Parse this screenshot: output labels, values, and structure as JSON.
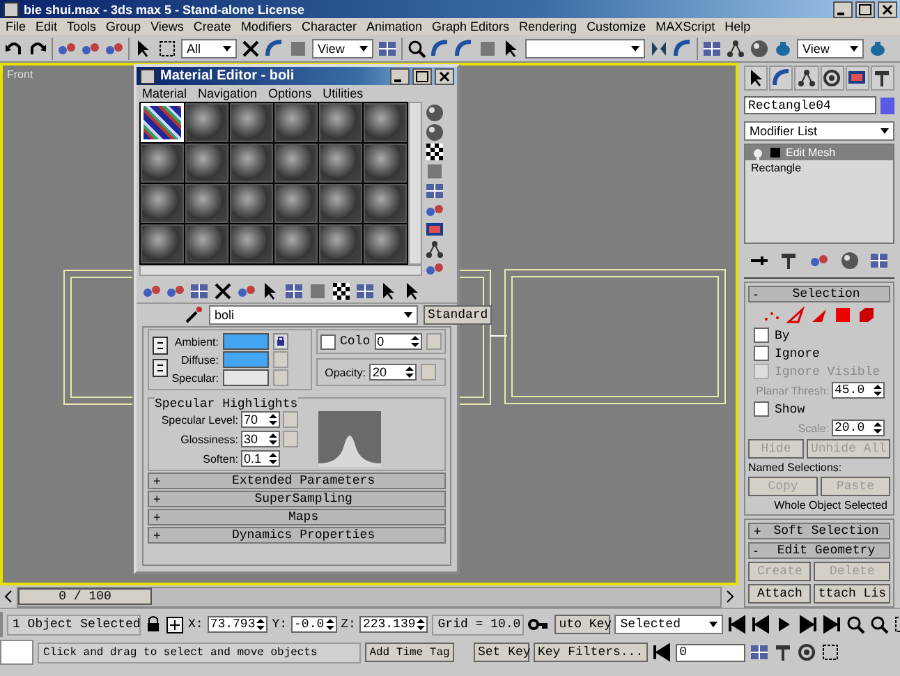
{
  "window": {
    "title": "bie shui.max - 3ds max 5 - Stand-alone License"
  },
  "menu": [
    "File",
    "Edit",
    "Tools",
    "Group",
    "Views",
    "Create",
    "Modifiers",
    "Character",
    "Animation",
    "Graph Editors",
    "Rendering",
    "Customize",
    "MAXScript",
    "Help"
  ],
  "toolbar": {
    "selection_filter": "All",
    "reference_coord": "View",
    "render_type": "View"
  },
  "viewport": {
    "label": "Front"
  },
  "time_slider": {
    "reading": "0 / 100",
    "level": 0
  },
  "material_editor": {
    "title": "Material Editor - boli",
    "menu": [
      "Material",
      "Navigation",
      "Options",
      "Utilities"
    ],
    "slots": [
      {
        "selected": true,
        "kind": "textured"
      },
      {
        "selected": false,
        "kind": "plain"
      },
      {
        "selected": false,
        "kind": "plain"
      },
      {
        "selected": false,
        "kind": "plain"
      },
      {
        "selected": false,
        "kind": "plain"
      },
      {
        "selected": false,
        "kind": "plain"
      },
      {
        "selected": false,
        "kind": "plain"
      },
      {
        "selected": false,
        "kind": "plain"
      },
      {
        "selected": false,
        "kind": "plain"
      },
      {
        "selected": false,
        "kind": "plain"
      },
      {
        "selected": false,
        "kind": "plain"
      },
      {
        "selected": false,
        "kind": "plain"
      },
      {
        "selected": false,
        "kind": "plain"
      },
      {
        "selected": false,
        "kind": "plain"
      },
      {
        "selected": false,
        "kind": "plain"
      },
      {
        "selected": false,
        "kind": "plain"
      },
      {
        "selected": false,
        "kind": "plain"
      },
      {
        "selected": false,
        "kind": "plain"
      },
      {
        "selected": false,
        "kind": "plain"
      },
      {
        "selected": false,
        "kind": "plain"
      },
      {
        "selected": false,
        "kind": "plain"
      },
      {
        "selected": false,
        "kind": "plain"
      },
      {
        "selected": false,
        "kind": "plain"
      },
      {
        "selected": false,
        "kind": "plain"
      }
    ],
    "material_name": "boli",
    "material_type": "Standard",
    "colors": [
      {
        "label": "Ambient:",
        "color": "#44a6f2"
      },
      {
        "label": "Diffuse:",
        "color": "#44a6f2"
      },
      {
        "label": "Specular:",
        "color": "#e6e6e6"
      }
    ],
    "self_illum": {
      "label": "Colo",
      "checked": false,
      "value": "0"
    },
    "opacity": {
      "label": "Opacity:",
      "value": "20"
    },
    "specular_highlights": {
      "title": "Specular Highlights",
      "fields": [
        {
          "label": "Specular Level:",
          "value": "70"
        },
        {
          "label": "Glossiness:",
          "value": "30"
        },
        {
          "label": "Soften:",
          "value": "0.1"
        }
      ]
    },
    "rollouts": [
      {
        "sign": "+",
        "label": "Extended Parameters"
      },
      {
        "sign": "+",
        "label": "SuperSampling"
      },
      {
        "sign": "+",
        "label": "Maps"
      },
      {
        "sign": "+",
        "label": "Dynamics Properties"
      }
    ]
  },
  "command_panel": {
    "object": {
      "name": "Rectangle04",
      "color": "#5a5ae6"
    },
    "modifier_list": "Modifier List",
    "stack": [
      {
        "label": "Edit Mesh",
        "selected": true,
        "kind": "modifier"
      },
      {
        "label": "Rectangle",
        "selected": false,
        "kind": "base"
      }
    ],
    "selection": {
      "sign": "-",
      "title": "Selection",
      "checkboxes": [
        {
          "label": "By",
          "checked": false,
          "disabled": false
        },
        {
          "label": "Ignore",
          "checked": false,
          "disabled": false
        },
        {
          "label": "Ignore Visible",
          "checked": false,
          "disabled": true
        }
      ],
      "planar_thresh": {
        "label": "Planar Thresh:",
        "value": "45.0"
      },
      "show": {
        "label": "Show",
        "checked": false,
        "disabled": false
      },
      "scale": {
        "label": "Scale:",
        "value": "20.0"
      },
      "buttons": [
        {
          "label": "Hide",
          "disabled": true
        },
        {
          "label": "Unhide All",
          "disabled": true
        }
      ],
      "named_label": "Named Selections:",
      "named_buttons": [
        {
          "label": "Copy",
          "disabled": true
        },
        {
          "label": "Paste",
          "disabled": true
        }
      ],
      "status": "Whole Object Selected"
    },
    "rollouts": [
      {
        "sign": "+",
        "label": "Soft Selection"
      },
      {
        "sign": "-",
        "label": "Edit Geometry"
      }
    ],
    "geometry_buttons": [
      {
        "label": "Create",
        "disabled": true
      },
      {
        "label": "Delete",
        "disabled": true
      },
      {
        "label": "Attach",
        "disabled": false
      },
      {
        "label": "ttach Lis",
        "disabled": false
      }
    ]
  },
  "status_bar": {
    "selection": "1 Object Selected",
    "coordinates": [
      {
        "label": "X:",
        "value": "73.793"
      },
      {
        "label": "Y:",
        "value": "-0.0"
      },
      {
        "label": "Z:",
        "value": "223.139"
      }
    ],
    "grid": "Grid = 10.0",
    "auto_key": "uto Key",
    "key_mode": "Selected",
    "prompt": "Click and drag to select and move objects",
    "time_tag": "Add Time Tag",
    "set_key": "Set Key",
    "key_filters": "Key Filters...",
    "frame": "0"
  }
}
